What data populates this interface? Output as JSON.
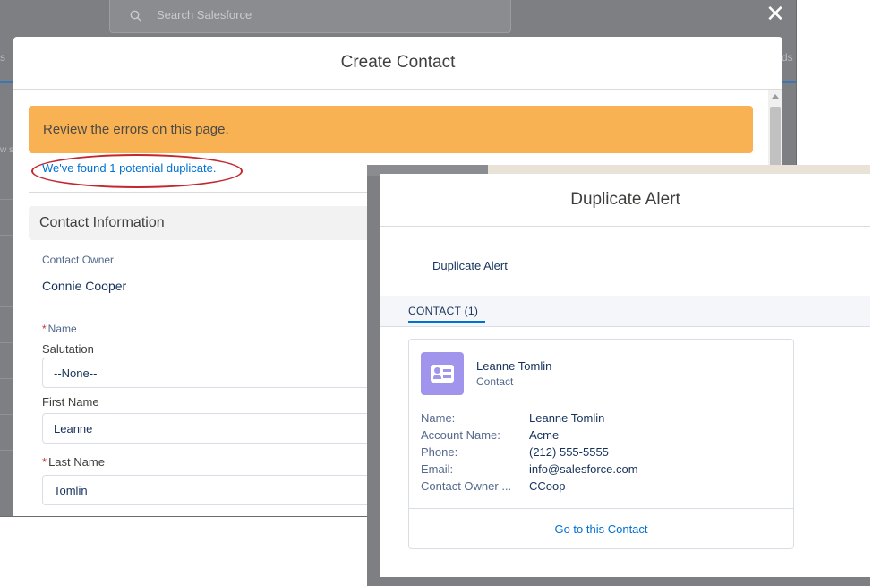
{
  "search": {
    "placeholder": "Search Salesforce"
  },
  "background": {
    "tab_left": "s",
    "tab_right": "ds",
    "side_text": "w s",
    "close": "✕"
  },
  "create_contact": {
    "title": "Create Contact",
    "error_banner": "Review the errors on this page.",
    "duplicate_link": "We've found 1 potential duplicate.",
    "section_title": "Contact Information",
    "owner_label": "Contact Owner",
    "owner_value": "Connie Cooper",
    "name_label": "Name",
    "salutation_label": "Salutation",
    "salutation_value": "--None--",
    "first_name_label": "First Name",
    "first_name_value": "Leanne",
    "last_name_label": "Last Name",
    "last_name_value": "Tomlin",
    "required_mark": "*"
  },
  "duplicate_alert": {
    "title": "Duplicate Alert",
    "subtitle": "Duplicate Alert",
    "tab_label": "CONTACT (1)",
    "record": {
      "name": "Leanne Tomlin",
      "type": "Contact",
      "fields": [
        {
          "key": "Name:",
          "value": "Leanne Tomlin"
        },
        {
          "key": "Account Name:",
          "value": "Acme"
        },
        {
          "key": "Phone:",
          "value": "(212) 555-5555"
        },
        {
          "key": "Email:",
          "value": "info@salesforce.com"
        },
        {
          "key": "Contact Owner ...",
          "value": "CCoop"
        }
      ],
      "action": "Go to this Contact"
    }
  },
  "colors": {
    "accent": "#0070d2",
    "warning": "#f8b153",
    "highlight_oval": "#c4262e",
    "avatar": "#a094ed"
  }
}
